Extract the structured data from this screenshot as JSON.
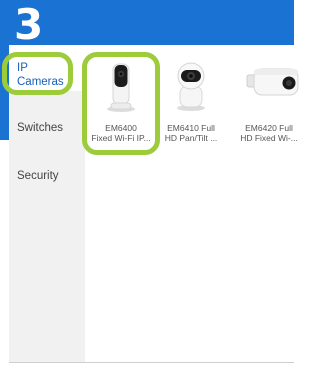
{
  "step": "3",
  "sidebar": {
    "items": [
      {
        "label": "IP\nCameras",
        "selected": true
      },
      {
        "label": "Switches",
        "selected": false
      },
      {
        "label": "Security",
        "selected": false
      }
    ]
  },
  "products": [
    {
      "name": "EM6400\nFixed Wi-Fi IP...",
      "icon": "indoor-camera-icon"
    },
    {
      "name": "EM6410 Full\nHD Pan/Tilt ...",
      "icon": "pan-tilt-camera-icon"
    },
    {
      "name": "EM6420 Full\nHD Fixed Wi-...",
      "icon": "bullet-camera-icon"
    }
  ],
  "colors": {
    "brand_blue": "#1a73d2",
    "highlight_green": "#9ccc3a",
    "sidebar_bg": "#f1f1f1",
    "selected_text": "#1a5fb8"
  }
}
